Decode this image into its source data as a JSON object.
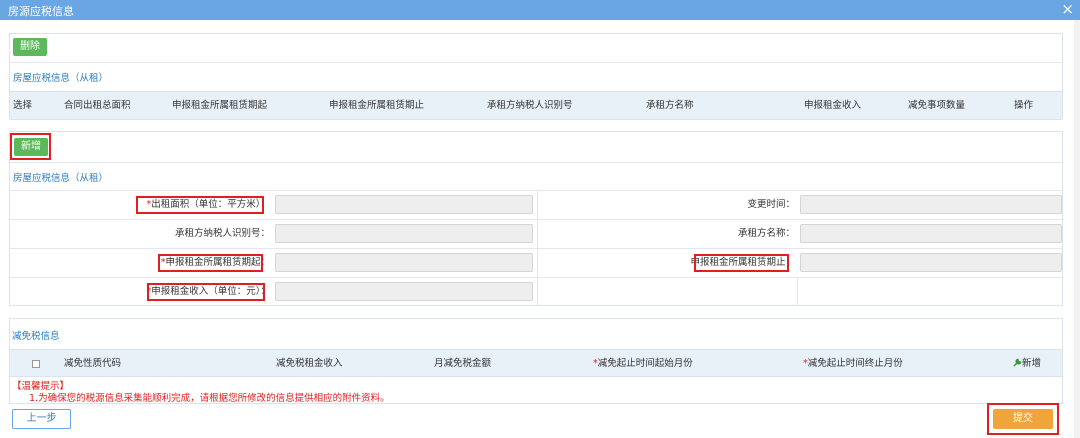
{
  "window": {
    "title": "房源应税信息",
    "close": "×"
  },
  "top_panel": {
    "delete_label": "删除",
    "section_title": "房屋应税信息（从租）",
    "columns": [
      "选择",
      "合同出租总面积",
      "申报租金所属租赁期起",
      "申报租金所属租赁期止",
      "承租方纳税人识别号",
      "承租方名称",
      "申报租金收入",
      "减免事项数量",
      "操作"
    ]
  },
  "form_panel": {
    "add_label": "新增",
    "section_title": "房屋应税信息（从租）",
    "fields": {
      "area": {
        "required": "*",
        "label": "出租面积（单位：平方米）："
      },
      "change_time": {
        "label": "变更时间："
      },
      "tenant_taxid": {
        "label": "承租方纳税人识别号："
      },
      "tenant_name": {
        "label": "承租方名称："
      },
      "lease_start": {
        "required": "*",
        "label": "申报租金所属租赁期起",
        "colon": "："
      },
      "lease_end": {
        "label": "申报租金所属租赁期止",
        "colon": "："
      },
      "rent_income": {
        "required": "*",
        "label": "申报租金收入（单位：元）",
        "colon": "："
      }
    }
  },
  "relief_panel": {
    "section_title": "减免税信息",
    "columns": [
      "减免性质代码",
      "减免税租金收入",
      "月减免税金额"
    ],
    "required_columns": [
      {
        "mark": "*",
        "label": "减免起止时间起始月份"
      },
      {
        "mark": "*",
        "label": "减免起止时间终止月份"
      }
    ],
    "add_label": "新增"
  },
  "warning": {
    "title": "【温馨提示】",
    "line1": "1.为确保您的税源信息采集能顺利完成，请根据您所修改的信息提供相应的附件资料。"
  },
  "footer": {
    "prev_label": "上一步",
    "submit_label": "提交"
  },
  "colors": {
    "accent": "#6aa6e4",
    "green": "#5cb85c",
    "submit": "#f0a53c",
    "highlight": "#e02020"
  },
  "icons": {
    "add_relief": "wrench-icon",
    "close": "close-icon"
  }
}
